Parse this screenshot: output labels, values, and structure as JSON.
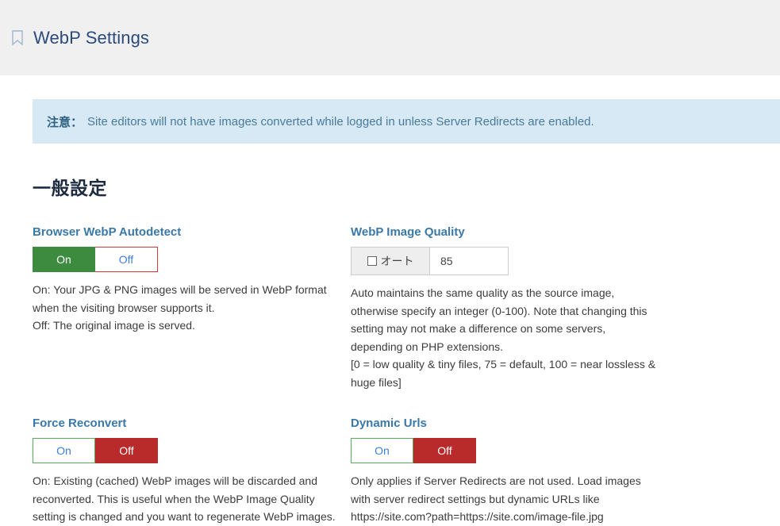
{
  "header": {
    "icon": "bookmark-icon",
    "title": "WebP Settings"
  },
  "notice": {
    "label": "注意：",
    "text": "Site editors will not have images converted while logged in unless Server Redirects are enabled."
  },
  "section": {
    "title": "一般設定"
  },
  "fields": {
    "browser_autodetect": {
      "label": "Browser WebP Autodetect",
      "on_label": "On",
      "off_label": "Off",
      "selected": "On",
      "desc_lines": [
        "On: Your JPG & PNG images will be served in WebP format when the visiting browser supports it.",
        "Off: The original image is served."
      ]
    },
    "image_quality": {
      "label": "WebP Image Quality",
      "auto_label": "オート",
      "auto_checked": false,
      "value": "85",
      "desc_lines": [
        "Auto maintains the same quality as the source image, otherwise specify an integer (0-100). Note that changing this setting may not make a difference on some servers, depending on PHP extensions.",
        "[0 = low quality & tiny files, 75 = default, 100 = near lossless & huge files]"
      ]
    },
    "force_reconvert": {
      "label": "Force Reconvert",
      "on_label": "On",
      "off_label": "Off",
      "selected": "Off",
      "desc_lines": [
        "On: Existing (cached) WebP images will be discarded and reconverted. This is useful when the WebP Image Quality setting is changed and you want to regenerate WebP images."
      ]
    },
    "dynamic_urls": {
      "label": "Dynamic Urls",
      "on_label": "On",
      "off_label": "Off",
      "selected": "Off",
      "desc_lines": [
        "Only applies if Server Redirects are not used. Load images with server redirect settings but dynamic URLs like https://site.com?path=https://site.com/image-file.jpg"
      ]
    }
  },
  "colors": {
    "title_blue": "#2b4a7d",
    "label_blue": "#3a78a8",
    "notice_bg": "#d6e9f5",
    "on_green": "#3c8b3f",
    "off_red": "#b92b2b",
    "header_bg": "#f0f0f0"
  }
}
